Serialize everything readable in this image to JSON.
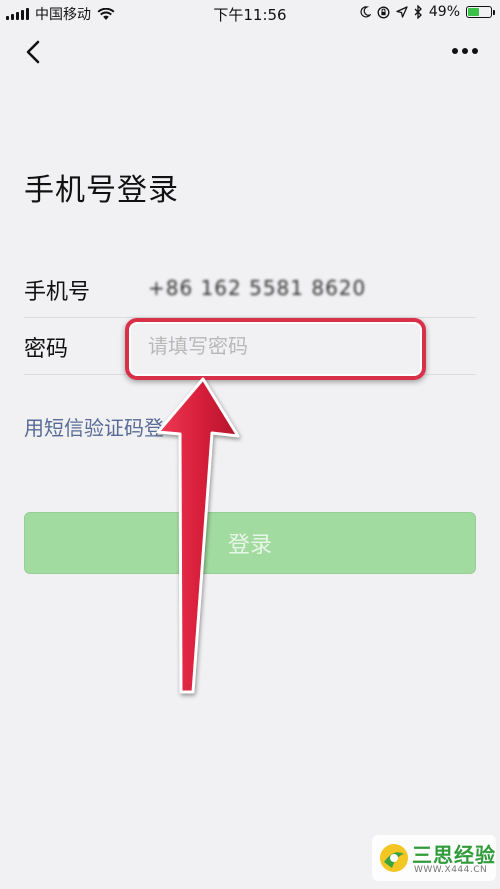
{
  "status_bar": {
    "carrier": "中国移动",
    "time": "下午11:56",
    "battery_percent": "49%",
    "battery_level": 0.49,
    "battery_color": "#39c247"
  },
  "nav": {
    "back_icon": "chevron-left-icon",
    "more_icon": "more-dots-icon"
  },
  "page": {
    "title": "手机号登录"
  },
  "form": {
    "phone_label": "手机号",
    "phone_value": "+86 162 5581 8620",
    "password_label": "密码",
    "password_placeholder": "请填写密码",
    "sms_login_link": "用短信验证码登"
  },
  "login_button": {
    "label": "登录",
    "color": "#a2dba0"
  },
  "annotation": {
    "highlight_color": "#d9304a"
  },
  "watermark": {
    "brand": "三思经验",
    "url": "WWW.X444.CN"
  }
}
